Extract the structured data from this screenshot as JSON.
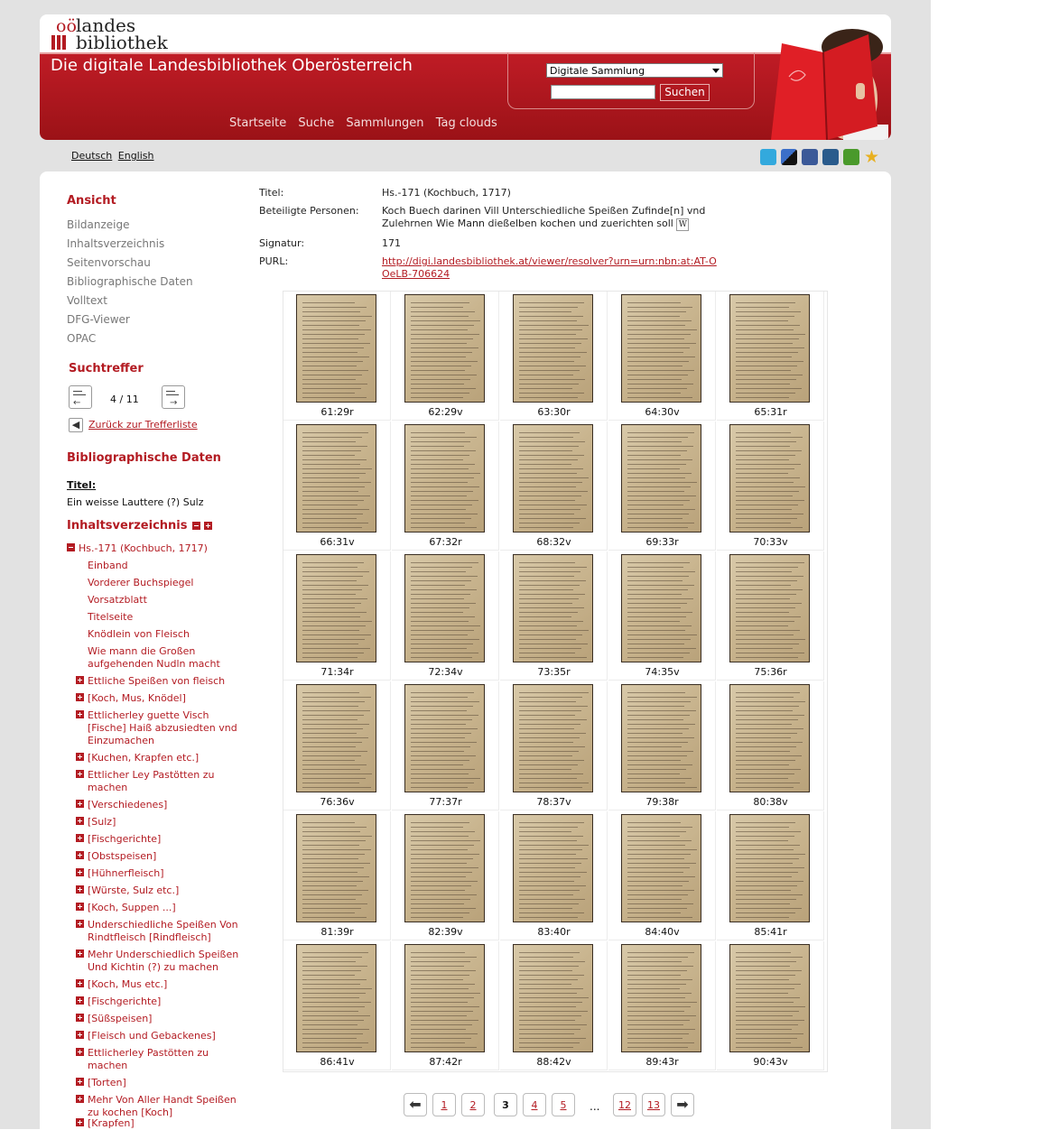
{
  "logo": {
    "oo": "oö",
    "line1": "landes",
    "line2": "bibliothek"
  },
  "header": {
    "site_title": "Die digitale Landesbibliothek Oberösterreich",
    "search_scope": "Digitale Sammlung",
    "search_value": "",
    "search_button": "Suchen",
    "nav": [
      "Startseite",
      "Suche",
      "Sammlungen",
      "Tag clouds"
    ]
  },
  "lang": [
    "Deutsch",
    "English"
  ],
  "social": [
    {
      "icon": "twitter-icon",
      "color": "#33a9dd"
    },
    {
      "icon": "delicious-icon",
      "color": "#3b6fc9"
    },
    {
      "icon": "facebook-icon",
      "color": "#3b5998"
    },
    {
      "icon": "digg-icon",
      "color": "#2a5b8c"
    },
    {
      "icon": "stumbleupon-icon",
      "color": "#4a9a2b"
    },
    {
      "icon": "favorite-star-icon",
      "color": "#e8b020"
    }
  ],
  "sidebar": {
    "ansicht_heading": "Ansicht",
    "ansicht_items": [
      "Bildanzeige",
      "Inhaltsverzeichnis",
      "Seitenvorschau",
      "Bibliographische Daten",
      "Volltext",
      "DFG-Viewer",
      "OPAC"
    ],
    "suchtreffer_heading": "Suchtreffer",
    "hit_counter": "4 / 11",
    "back_link": "Zurück zur Trefferliste",
    "biblio_heading": "Bibliographische Daten",
    "titel_label": "Titel:",
    "titel_value": "Ein weisse Lauttere (?) Sulz",
    "toc_heading": "Inhaltsverzeichnis",
    "toc_root": "Hs.-171 (Kochbuch, 1717)",
    "toc_plain": [
      "Einband",
      "Vorderer Buchspiegel",
      "Vorsatzblatt",
      "Titelseite",
      "Knödlein von Fleisch",
      "Wie mann die Großen aufgehenden Nudln macht"
    ],
    "toc_expandable": [
      "Ettliche Speißen von fleisch",
      "[Koch, Mus, Knödel]",
      "Ettlicherley guette Visch [Fische] Haiß abzusiedten vnd Einzumachen",
      "[Kuchen, Krapfen etc.]",
      "Ettlicher Ley Pastötten zu machen",
      "[Verschiedenes]",
      "[Sulz]",
      "[Fischgerichte]",
      "[Obstspeisen]",
      "[Hühnerfleisch]",
      "[Würste, Sulz etc.]",
      "[Koch, Suppen ...]",
      "Underschiedliche Speißen Von Rindtfleisch [Rindfleisch]",
      "Mehr Underschiedlich Speißen Und Kichtin (?) zu machen",
      "[Koch, Mus etc.]",
      "[Fischgerichte]",
      "[Süßspeisen]",
      "[Fleisch und Gebackenes]",
      "Ettlicherley Pastötten zu machen",
      "[Torten]",
      "Mehr Von Aller Handt Speißen zu kochen [Koch]",
      "[Krapfen]"
    ]
  },
  "meta": {
    "titel_label": "Titel:",
    "titel_value": "Hs.-171 (Kochbuch, 1717)",
    "personen_label": "Beteiligte Personen:",
    "personen_value": "Koch Buech darinen Vill Unterschiedliche Speißen Zufinde[n] vnd Zulehrnen Wie Mann dießelben kochen und zuerichten soll",
    "signatur_label": "Signatur:",
    "signatur_value": "171",
    "purl_label": "PURL:",
    "purl_value": "http://digi.landesbibliothek.at/viewer/resolver?urn=urn:nbn:at:AT-OOeLB-706624"
  },
  "thumbnails": [
    "61:29r",
    "62:29v",
    "63:30r",
    "64:30v",
    "65:31r",
    "66:31v",
    "67:32r",
    "68:32v",
    "69:33r",
    "70:33v",
    "71:34r",
    "72:34v",
    "73:35r",
    "74:35v",
    "75:36r",
    "76:36v",
    "77:37r",
    "78:37v",
    "79:38r",
    "80:38v",
    "81:39r",
    "82:39v",
    "83:40r",
    "84:40v",
    "85:41r",
    "86:41v",
    "87:42r",
    "88:42v",
    "89:43r",
    "90:43v"
  ],
  "pager": {
    "pages": [
      "1",
      "2",
      "3",
      "4",
      "5"
    ],
    "current": "3",
    "ellipsis": "...",
    "tail": [
      "12",
      "13"
    ]
  }
}
